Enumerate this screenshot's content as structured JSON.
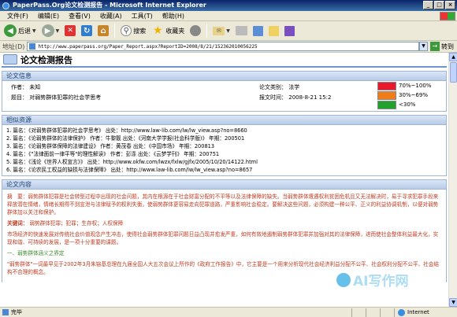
{
  "window": {
    "title": "PaperPass.Org论文检测报告 - Microsoft Internet Explorer",
    "controls": [
      "_",
      "□",
      "×"
    ]
  },
  "menu": [
    "文件(F)",
    "编辑(E)",
    "查看(V)",
    "收藏(A)",
    "工具(T)",
    "帮助(H)"
  ],
  "toolbar": {
    "back": "后退",
    "search": "搜索",
    "favorites": "收藏夹"
  },
  "address": {
    "label": "地址(D)",
    "url": "http://www.paperpass.org/Paper_Report.aspx?ReportID=2008/8/21/152362010056225",
    "go": "转到"
  },
  "report": {
    "title": "论文检测报告"
  },
  "info": {
    "heading": "论文信息",
    "author_label": "作者：",
    "author": "未知",
    "title_label": "题目：",
    "title": "对弱势群体犯罪的社会学思考",
    "category_label": "论文类别：",
    "category": "法学",
    "time_label": "报文时间：",
    "time": "2008-8-21 15:2",
    "legend": [
      {
        "color": "#e8192c",
        "label": "70%~100%"
      },
      {
        "color": "#f07c1a",
        "label": "30%~69%"
      },
      {
        "color": "#22a12e",
        "label": "<30%"
      }
    ]
  },
  "resources": {
    "heading": "相似资源",
    "items": [
      "1. 篇名：《对弱势群体犯罪的社会学思考》    出处：http://www.law-lib.com/lw/lw_view.asp?no=8660",
      "2. 篇名：《论弱势群体的法律保护》   作者：牛黎靓   出处：《河南大学学报(社会科学版)》   年期：200501",
      "3. 篇名：《论弱势群体保障的法律建设》   作者：黄茂春   出处：《中国市场》   年期：200813",
      "4. 篇名：《\"法律面前一律平等\"的理性解读》   作者：彭涤   出处：《云梦学刊》   年期：200751",
      "5. 篇名：《浅论《世界人权宣言》》   出处：http://www.okfw.com/lwzx/fxlw/gjfx/2005/10/20/14122.html",
      "6. 篇名：《论农民工权益的缺损与法律保障》   出处：http://www.law-lib.com/lw/lw_view.asp?no=8657"
    ]
  },
  "content": {
    "heading": "论文内容",
    "abstract": "摘　要：弱势群体犯罪是社会转型过程中出现的社会问题，其内在根源在于社会财富分配的不平等以及法律保障的缺失。当弱势群体遭遇权利贫困危机且又无法解决时，易于寻求犯罪手段来释放潜在情绪，情绪长期得不到宣泄与法律赋予的权利失衡，使弱势群体更容易走向犯罪道路，严重影响社会稳定。要解决这些问题，必须构建一种公平、正义的利益协调机制，以便对弱势群体加以关注和保护。",
    "keywords_label": "关键词：",
    "keywords": "弱势群体犯罪；犯罪；生存权；人权保障",
    "para2": "市场经济的快速发展对传统社会价值观念产生冲击，使得社会弱势群体犯罪问题日益凸现并愈发严重，如何有效地遏制弱势群体犯罪并加强对其的法律保障，进而使社会整体利益最大化，实现和谐、可持续的发展，是一项十分重要的课题。",
    "section1": "一、弱势群体涵义之界定",
    "para3": "\"弱势群体\"一词最早见于2002年3月朱镕基总理在九届全国人大五次会议上所作的《政府工作报告》中，它主要是一个用来分析现代社会经济利益分配不公平、社会权利分配不公平、社会结构不合理的概念。"
  },
  "watermark": "AI写作网",
  "status": {
    "text": "完毕",
    "zone": "Internet"
  }
}
